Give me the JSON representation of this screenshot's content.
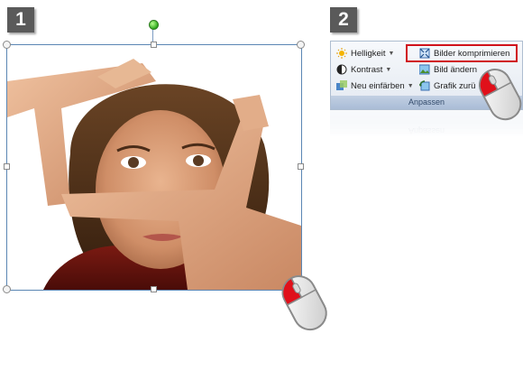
{
  "steps": {
    "step1": "1",
    "step2": "2"
  },
  "ribbon": {
    "group_label": "Anpassen",
    "items": {
      "brightness": "Helligkeit",
      "contrast": "Kontrast",
      "recolor": "Neu einfärben",
      "compress": "Bilder komprimieren",
      "change": "Bild ändern",
      "reset": "Grafik zurü"
    },
    "reflection_label": "Anpassen"
  },
  "icons": {
    "rotate": "rotate-handle-icon",
    "mouse": "mouse-left-click-icon",
    "brightness": "sun-icon",
    "contrast": "half-circle-icon",
    "recolor": "recolor-icon",
    "compress": "compress-pictures-icon",
    "change": "change-picture-icon",
    "reset": "reset-picture-icon"
  },
  "colors": {
    "badge": "#5a5a5a",
    "selection_border": "#5b86b4",
    "highlight": "#d0121b",
    "mouse_button": "#e0101a",
    "rotate_handle": "#2faa1d"
  }
}
